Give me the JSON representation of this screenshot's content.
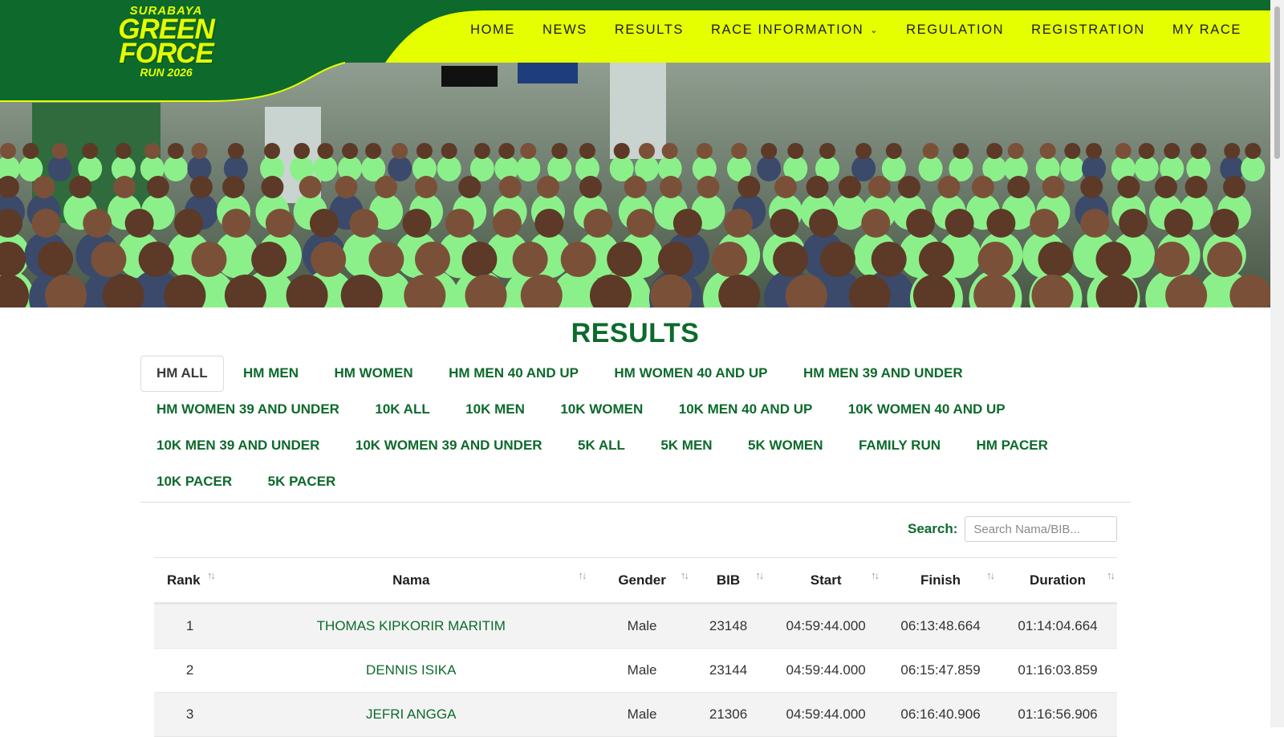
{
  "brand": {
    "logo_line1": "SURABAYA",
    "logo_line2": "GREEN",
    "logo_line3": "FORCE",
    "logo_line4": "RUN 2026"
  },
  "nav": {
    "items": [
      "HOME",
      "NEWS",
      "RESULTS",
      "RACE INFORMATION",
      "REGULATION",
      "REGISTRATION",
      "MY RACE"
    ]
  },
  "results": {
    "title": "RESULTS",
    "tabs": [
      "HM ALL",
      "HM MEN",
      "HM WOMEN",
      "HM MEN 40 AND UP",
      "HM WOMEN 40 AND UP",
      "HM MEN 39 AND UNDER",
      "HM WOMEN 39 AND UNDER",
      "10K ALL",
      "10K MEN",
      "10K WOMEN",
      "10K MEN 40 AND UP",
      "10K WOMEN 40 AND UP",
      "10K MEN 39 AND UNDER",
      "10K WOMEN 39 AND UNDER",
      "5K ALL",
      "5K MEN",
      "5K WOMEN",
      "FAMILY RUN",
      "HM PACER",
      "10K PACER",
      "5K PACER"
    ],
    "active_tab": "HM ALL",
    "search_label": "Search:",
    "search_placeholder": "Search Nama/BIB...",
    "columns": [
      "Rank",
      "Nama",
      "Gender",
      "BIB",
      "Start",
      "Finish",
      "Duration"
    ],
    "rows": [
      {
        "rank": "1",
        "nama": "THOMAS KIPKORIR MARITIM",
        "gender": "Male",
        "bib": "23148",
        "start": "04:59:44.000",
        "finish": "06:13:48.664",
        "duration": "01:14:04.664"
      },
      {
        "rank": "2",
        "nama": "DENNIS ISIKA",
        "gender": "Male",
        "bib": "23144",
        "start": "04:59:44.000",
        "finish": "06:15:47.859",
        "duration": "01:16:03.859"
      },
      {
        "rank": "3",
        "nama": "JEFRI ANGGA",
        "gender": "Male",
        "bib": "21306",
        "start": "04:59:44.000",
        "finish": "06:16:40.906",
        "duration": "01:16:56.906"
      }
    ]
  },
  "colors": {
    "brand_green": "#0d6a2c",
    "brand_yellow": "#e5ff00",
    "shirt_green": "#8cf08a"
  }
}
